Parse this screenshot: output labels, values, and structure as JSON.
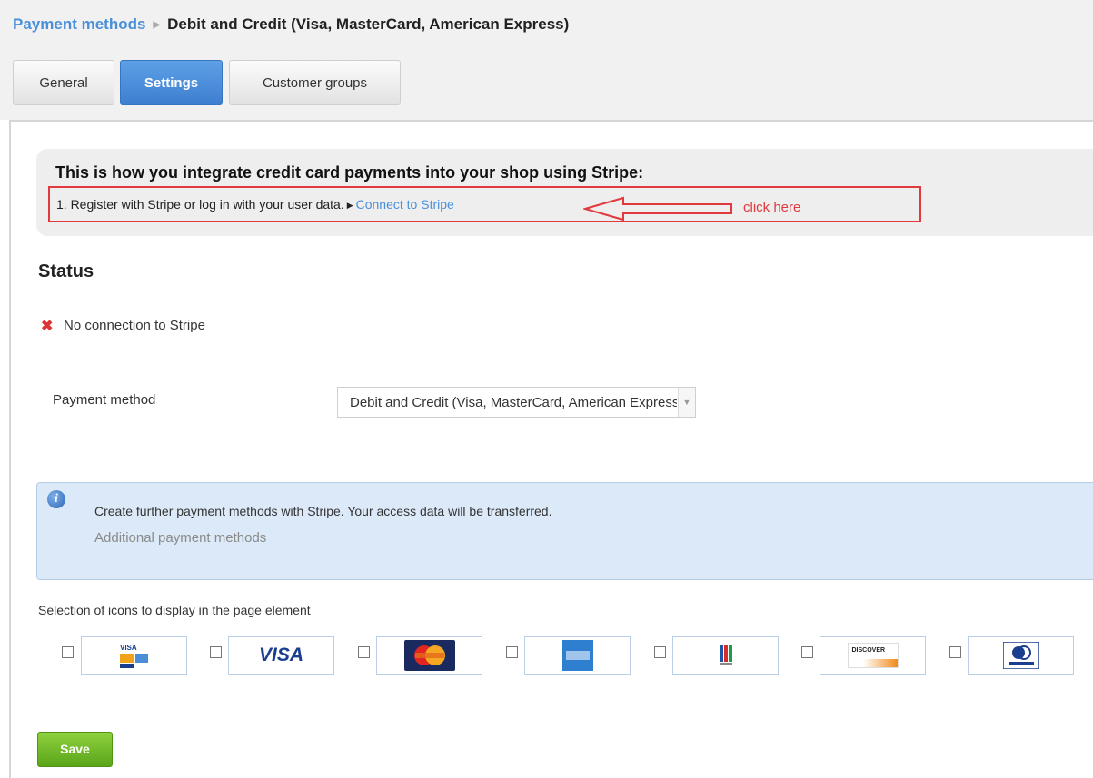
{
  "breadcrumb": {
    "parent": "Payment methods",
    "current": "Debit and Credit (Visa, MasterCard, American Express)"
  },
  "tabs": [
    {
      "label": "General",
      "active": false
    },
    {
      "label": "Settings",
      "active": true
    },
    {
      "label": "Customer groups",
      "active": false
    }
  ],
  "intro": {
    "title": "This is how you integrate credit card payments into your shop using Stripe:",
    "step_text": "1. Register with Stripe or log in with your user data.",
    "connect_link": "Connect to Stripe",
    "annotation": "click here",
    "annotation_color": "#e0393e"
  },
  "status": {
    "title": "Status",
    "icon": "x-icon",
    "text": "No connection to Stripe"
  },
  "payment_method": {
    "label": "Payment method",
    "selected_value": "Debit and Credit (Visa, MasterCard, American Express)"
  },
  "info": {
    "icon": "info-icon",
    "text": "Create further payment methods with Stripe. Your access data will be transferred.",
    "link": "Additional payment methods"
  },
  "icon_selection": {
    "label": "Selection of icons to display in the page element",
    "cards": [
      {
        "icon": "visa-mastercard-amex-icon",
        "checked": false
      },
      {
        "icon": "visa-icon",
        "checked": false,
        "text": "VISA"
      },
      {
        "icon": "mastercard-icon",
        "checked": false
      },
      {
        "icon": "american-express-icon",
        "checked": false
      },
      {
        "icon": "jcb-icon",
        "checked": false
      },
      {
        "icon": "discover-icon",
        "checked": false,
        "text": "DISCOVER"
      },
      {
        "icon": "diners-club-icon",
        "checked": false
      }
    ]
  },
  "actions": {
    "save_label": "Save",
    "save_color": "#6cb82a"
  }
}
